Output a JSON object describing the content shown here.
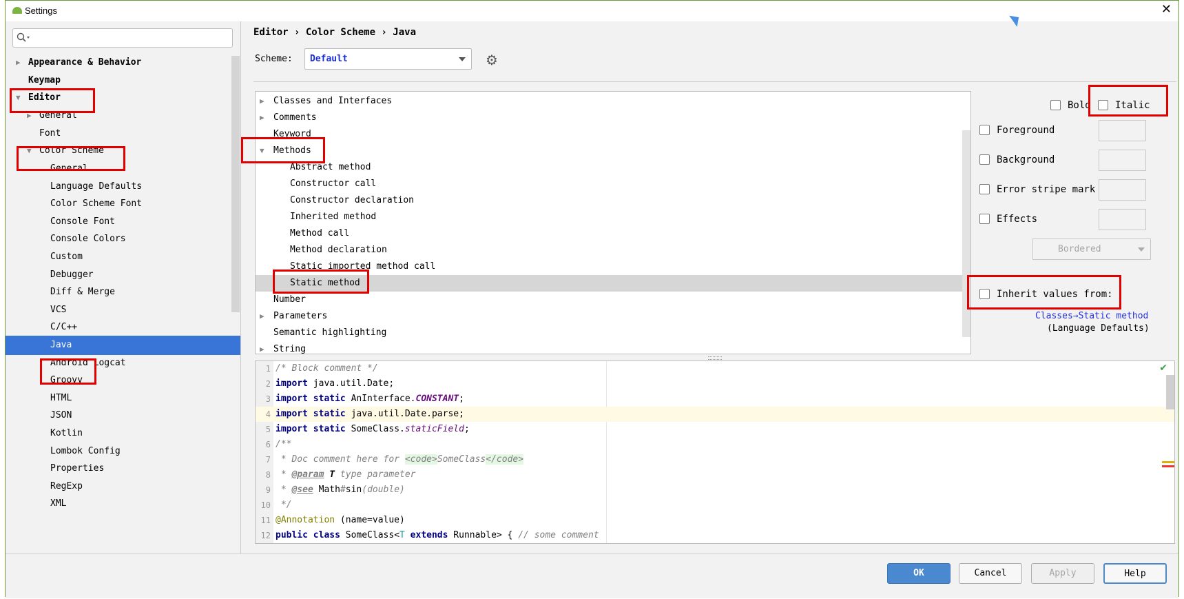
{
  "window": {
    "title": "Settings",
    "close_glyph": "✕"
  },
  "search": {
    "placeholder": "",
    "icon": "search-icon"
  },
  "tree": {
    "items": [
      {
        "label": "Appearance & Behavior",
        "arrow": "▶"
      },
      {
        "label": "Keymap",
        "arrow": ""
      },
      {
        "label": "Editor",
        "arrow": "▼"
      },
      {
        "label": "General",
        "arrow": "▶"
      },
      {
        "label": "Font",
        "arrow": ""
      },
      {
        "label": "Color Scheme",
        "arrow": "▼"
      },
      {
        "label": "General",
        "arrow": ""
      },
      {
        "label": "Language Defaults",
        "arrow": ""
      },
      {
        "label": "Color Scheme Font",
        "arrow": ""
      },
      {
        "label": "Console Font",
        "arrow": ""
      },
      {
        "label": "Console Colors",
        "arrow": ""
      },
      {
        "label": "Custom",
        "arrow": ""
      },
      {
        "label": "Debugger",
        "arrow": ""
      },
      {
        "label": "Diff & Merge",
        "arrow": ""
      },
      {
        "label": "VCS",
        "arrow": ""
      },
      {
        "label": "C/C++",
        "arrow": ""
      },
      {
        "label": "Java",
        "arrow": ""
      },
      {
        "label": "Android Logcat",
        "arrow": ""
      },
      {
        "label": "Groovy",
        "arrow": ""
      },
      {
        "label": "HTML",
        "arrow": ""
      },
      {
        "label": "JSON",
        "arrow": ""
      },
      {
        "label": "Kotlin",
        "arrow": ""
      },
      {
        "label": "Lombok Config",
        "arrow": ""
      },
      {
        "label": "Properties",
        "arrow": ""
      },
      {
        "label": "RegExp",
        "arrow": ""
      },
      {
        "label": "XML",
        "arrow": ""
      }
    ]
  },
  "header": {
    "breadcrumb": "Editor › Color Scheme › Java"
  },
  "scheme": {
    "label": "Scheme:",
    "value": "Default"
  },
  "attributes": {
    "rows": [
      {
        "label": "Classes and Interfaces",
        "arrow": "▶"
      },
      {
        "label": "Comments",
        "arrow": "▶"
      },
      {
        "label": "Keyword",
        "arrow": ""
      },
      {
        "label": "Methods",
        "arrow": "▼"
      },
      {
        "label": "Abstract method",
        "arrow": ""
      },
      {
        "label": "Constructor call",
        "arrow": ""
      },
      {
        "label": "Constructor declaration",
        "arrow": ""
      },
      {
        "label": "Inherited method",
        "arrow": ""
      },
      {
        "label": "Method call",
        "arrow": ""
      },
      {
        "label": "Method declaration",
        "arrow": ""
      },
      {
        "label": "Static imported method call",
        "arrow": ""
      },
      {
        "label": "Static method",
        "arrow": ""
      },
      {
        "label": "Number",
        "arrow": ""
      },
      {
        "label": "Parameters",
        "arrow": "▶"
      },
      {
        "label": "Semantic highlighting",
        "arrow": ""
      },
      {
        "label": "String",
        "arrow": "▶"
      }
    ]
  },
  "options": {
    "bold": "Bold",
    "italic": "Italic",
    "foreground": "Foreground",
    "background": "Background",
    "error_stripe": "Error stripe mark",
    "effects": "Effects",
    "effect_type": "Bordered",
    "inherit": "Inherit values from:",
    "inherit_link": "Classes→Static method",
    "inherit_sub": "(Language Defaults)"
  },
  "editor": {
    "line_numbers": [
      "1",
      "2",
      "3",
      "4",
      "5",
      "6",
      "7",
      "8",
      "9",
      "10",
      "11",
      "12"
    ]
  },
  "buttons": {
    "ok": "OK",
    "cancel": "Cancel",
    "apply": "Apply",
    "help": "Help"
  },
  "colors": {
    "selection": "#3875d7",
    "ok_button": "#4a88d0",
    "highlight_box": "#e00000",
    "keyword": "#000080",
    "link": "#2530d8"
  }
}
